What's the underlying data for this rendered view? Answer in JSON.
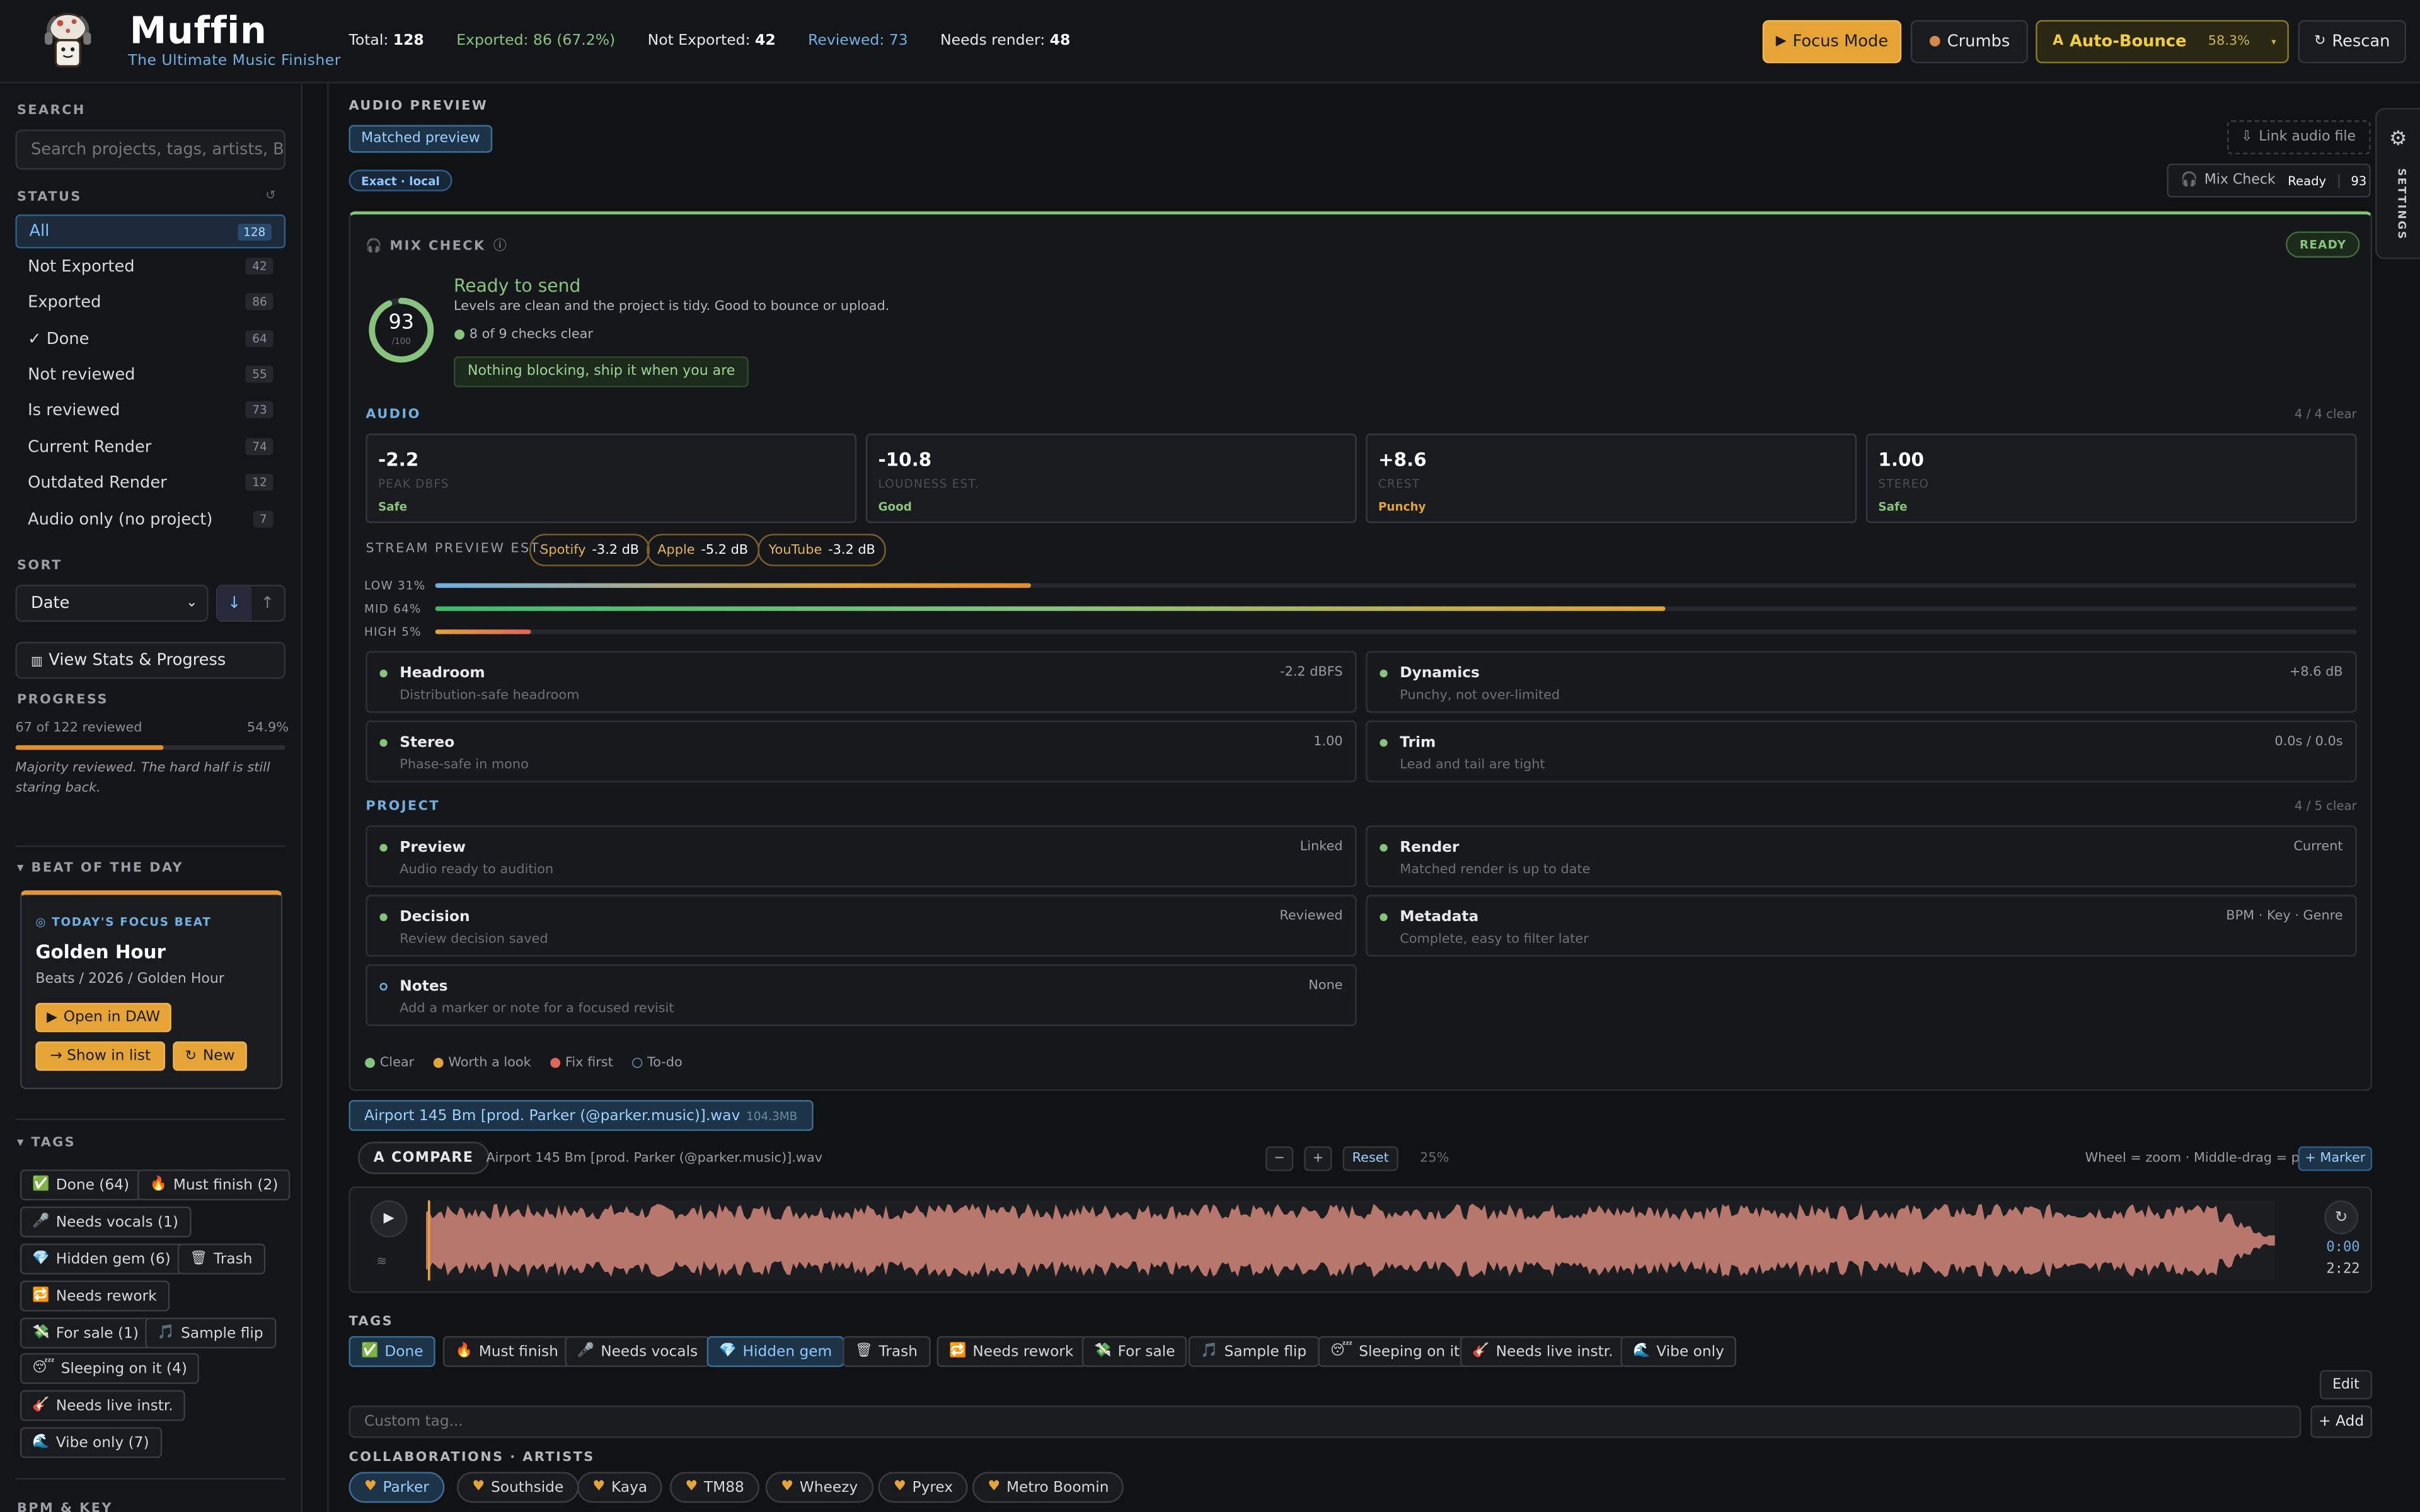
{
  "app": {
    "name": "Muffin",
    "subtitle": "The Ultimate Music Finisher"
  },
  "header": {
    "stats": [
      {
        "label": "Total: ",
        "value": "128"
      },
      {
        "label": "Exported: 86 (67.2%)",
        "value": ""
      },
      {
        "label": "Not Exported: ",
        "value": "42"
      },
      {
        "label": "Reviewed: 73",
        "value": ""
      },
      {
        "label": "Needs render: ",
        "value": "48"
      }
    ],
    "focus_label": "Focus Mode",
    "crumbs_label": "Crumbs",
    "autobounce_label": "Auto-Bounce",
    "autobounce_pct": "58.3%",
    "rescan_label": "Rescan"
  },
  "sidebar": {
    "search_heading": "SEARCH",
    "search_placeholder": "Search projects, tags, artists, BPM",
    "status_heading": "STATUS",
    "status_items": [
      {
        "label": "All",
        "count": "128"
      },
      {
        "label": "Not Exported",
        "count": "42"
      },
      {
        "label": "Exported",
        "count": "86"
      },
      {
        "label": "✓ Done",
        "count": "64"
      },
      {
        "label": "Not reviewed",
        "count": "55"
      },
      {
        "label": "Is reviewed",
        "count": "73"
      },
      {
        "label": "Current Render",
        "count": "74"
      },
      {
        "label": "Outdated Render",
        "count": "12"
      },
      {
        "label": "Audio only (no project)",
        "count": "7"
      }
    ],
    "sort_heading": "SORT",
    "sort_value": "Date",
    "stats_button": "View Stats & Progress",
    "progress_heading": "PROGRESS",
    "progress_text": "67 of 122 reviewed",
    "progress_pct": "54.9%",
    "progress_fraction": 0.549,
    "progress_note": "Majority reviewed. The hard half is still staring back.",
    "beat_heading": "BEAT OF THE DAY",
    "beat_kicker": "TODAY'S FOCUS BEAT",
    "beat_title": "Golden Hour",
    "beat_path": "Beats / 2026 / Golden Hour",
    "beat_open": "Open in DAW",
    "beat_show": "→ Show in list",
    "beat_new": "New",
    "tags_heading": "TAGS",
    "tags": [
      {
        "icon": "✅",
        "label": "Done (64)"
      },
      {
        "icon": "🔥",
        "label": "Must finish (2)"
      },
      {
        "icon": "🎤",
        "label": "Needs vocals (1)"
      },
      {
        "icon": "💎",
        "label": "Hidden gem (6)"
      },
      {
        "icon": "🗑",
        "label": "Trash"
      },
      {
        "icon": "🔁",
        "label": "Needs rework"
      },
      {
        "icon": "💸",
        "label": "For sale (1)"
      },
      {
        "icon": "🎵",
        "label": "Sample flip"
      },
      {
        "icon": "😴",
        "label": "Sleeping on it (4)"
      },
      {
        "icon": "🎸",
        "label": "Needs live instr."
      },
      {
        "icon": "🌊",
        "label": "Vibe only (7)"
      }
    ],
    "bottom_heading": "BPM & KEY"
  },
  "preview": {
    "heading": "AUDIO PREVIEW",
    "matched": "Matched preview",
    "exact": "Exact · local",
    "link_audio": "Link audio file",
    "mixcheck_chip": "Mix Check",
    "mixcheck_ready": "Ready",
    "mixcheck_score": "93",
    "settings_label": "SETTINGS"
  },
  "mixcheck": {
    "heading": "MIX CHECK",
    "badge": "READY",
    "score": "93",
    "score_max": "/100",
    "score_fraction": 0.93,
    "title": "Ready to send",
    "desc": "Levels are clean and the project is tidy. Good to bounce or upload.",
    "checks": "8 of 9 checks clear",
    "note": "Nothing blocking, ship it when you are",
    "audio_heading": "AUDIO",
    "audio_count": "4 / 4 clear",
    "metrics": [
      {
        "value": "-2.2",
        "label": "PEAK DBFS",
        "status": "Safe"
      },
      {
        "value": "-10.8",
        "label": "LOUDNESS EST.",
        "status": "Good"
      },
      {
        "value": "+8.6",
        "label": "CREST",
        "status": "Punchy"
      },
      {
        "value": "1.00",
        "label": "STEREO",
        "status": "Safe"
      }
    ],
    "stream_heading": "STREAM PREVIEW EST.",
    "streams": [
      {
        "name": "Spotify",
        "value": "-3.2 dB"
      },
      {
        "name": "Apple",
        "value": "-5.2 dB"
      },
      {
        "name": "YouTube",
        "value": "-3.2 dB"
      }
    ],
    "bands": [
      {
        "label": "LOW 31%",
        "fraction": 0.31
      },
      {
        "label": "MID 64%",
        "fraction": 0.64
      },
      {
        "label": "HIGH 5%",
        "fraction": 0.05
      }
    ],
    "audio_checks": [
      {
        "title": "Headroom",
        "desc": "Distribution-safe headroom",
        "value": "-2.2 dBFS"
      },
      {
        "title": "Dynamics",
        "desc": "Punchy, not over-limited",
        "value": "+8.6 dB"
      },
      {
        "title": "Stereo",
        "desc": "Phase-safe in mono",
        "value": "1.00"
      },
      {
        "title": "Trim",
        "desc": "Lead and tail are tight",
        "value": "0.0s / 0.0s"
      }
    ],
    "project_heading": "PROJECT",
    "project_count": "4 / 5 clear",
    "project_checks": [
      {
        "title": "Preview",
        "desc": "Audio ready to audition",
        "value": "Linked"
      },
      {
        "title": "Render",
        "desc": "Matched render is up to date",
        "value": "Current"
      },
      {
        "title": "Decision",
        "desc": "Review decision saved",
        "value": "Reviewed"
      },
      {
        "title": "Metadata",
        "desc": "Complete, easy to filter later",
        "value": "BPM · Key · Genre"
      },
      {
        "title": "Notes",
        "desc": "Add a marker or note for a focused revisit",
        "value": "None"
      }
    ],
    "legend": [
      {
        "label": "Clear",
        "color": "#86c47e"
      },
      {
        "label": "Worth a look",
        "color": "#e0a43a"
      },
      {
        "label": "Fix first",
        "color": "#e0665a"
      },
      {
        "label": "To-do",
        "color": "#6fb0e0"
      }
    ]
  },
  "player": {
    "file_label": "Airport 145 Bm [prod. Parker (@parker.music)].wav",
    "file_size": "104.3MB",
    "compare_label": "COMPARE",
    "compare_file": "Airport 145 Bm [prod. Parker (@parker.music)].wav",
    "zoom_minus": "−",
    "zoom_plus": "+",
    "reset": "Reset",
    "zoom_pct": "25%",
    "hint": "Wheel = zoom · Middle-drag = pan",
    "marker": "+ Marker",
    "time_current": "0:00",
    "time_total": "2:22"
  },
  "tags_section": {
    "heading": "TAGS",
    "items": [
      {
        "icon": "✅",
        "label": "Done",
        "on": true
      },
      {
        "icon": "🔥",
        "label": "Must finish",
        "on": false
      },
      {
        "icon": "🎤",
        "label": "Needs vocals",
        "on": false
      },
      {
        "icon": "💎",
        "label": "Hidden gem",
        "on": true
      },
      {
        "icon": "🗑",
        "label": "Trash",
        "on": false
      },
      {
        "icon": "🔁",
        "label": "Needs rework",
        "on": false
      },
      {
        "icon": "💸",
        "label": "For sale",
        "on": false
      },
      {
        "icon": "🎵",
        "label": "Sample flip",
        "on": false
      },
      {
        "icon": "😴",
        "label": "Sleeping on it",
        "on": false
      },
      {
        "icon": "🎸",
        "label": "Needs live instr.",
        "on": false
      },
      {
        "icon": "🌊",
        "label": "Vibe only",
        "on": false
      }
    ],
    "edit": "Edit",
    "custom_placeholder": "Custom tag...",
    "add": "+ Add"
  },
  "collabs": {
    "heading": "COLLABORATIONS · ARTISTS",
    "items": [
      "Parker",
      "Southside",
      "Kaya",
      "TM88",
      "Wheezy",
      "Pyrex",
      "Metro Boomin"
    ]
  }
}
